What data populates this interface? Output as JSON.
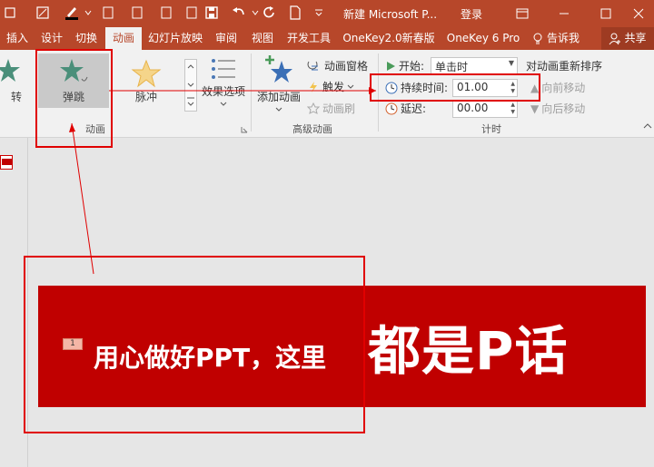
{
  "titlebar": {
    "title": "新建 Microsoft P...",
    "login": "登录"
  },
  "tabs": [
    {
      "label": "插入"
    },
    {
      "label": "设计"
    },
    {
      "label": "切换"
    },
    {
      "label": "动画"
    },
    {
      "label": "幻灯片放映"
    },
    {
      "label": "审阅"
    },
    {
      "label": "视图"
    },
    {
      "label": "开发工具"
    },
    {
      "label": "OneKey2.0新春版"
    },
    {
      "label": "OneKey 6 Pro"
    }
  ],
  "tell_me": "告诉我",
  "share": "共享",
  "ribbon": {
    "gallery": {
      "partial_label": "转",
      "selected_label": "弹跳",
      "next_label": "脉冲",
      "group_label": "动画"
    },
    "effect_options": "效果选项",
    "add_animation": "添加动画",
    "animation_pane": "动画窗格",
    "trigger": "触发",
    "animation_painter": "动画刷",
    "advanced_group": "高级动画",
    "start_label": "开始:",
    "start_value": "单击时",
    "duration_label": "持续时间:",
    "duration_value": "01.00",
    "delay_label": "延迟:",
    "delay_value": "00.00",
    "timing_group": "计时",
    "reorder_title": "对动画重新排序",
    "move_earlier": "向前移动",
    "move_later": "向后移动"
  },
  "slide": {
    "badge": "1",
    "text_small": "用心做好PPT，这里",
    "text_big": "都是P话"
  },
  "colors": {
    "accent": "#b7472a",
    "banner": "#c00000",
    "annotation": "#e00000"
  }
}
